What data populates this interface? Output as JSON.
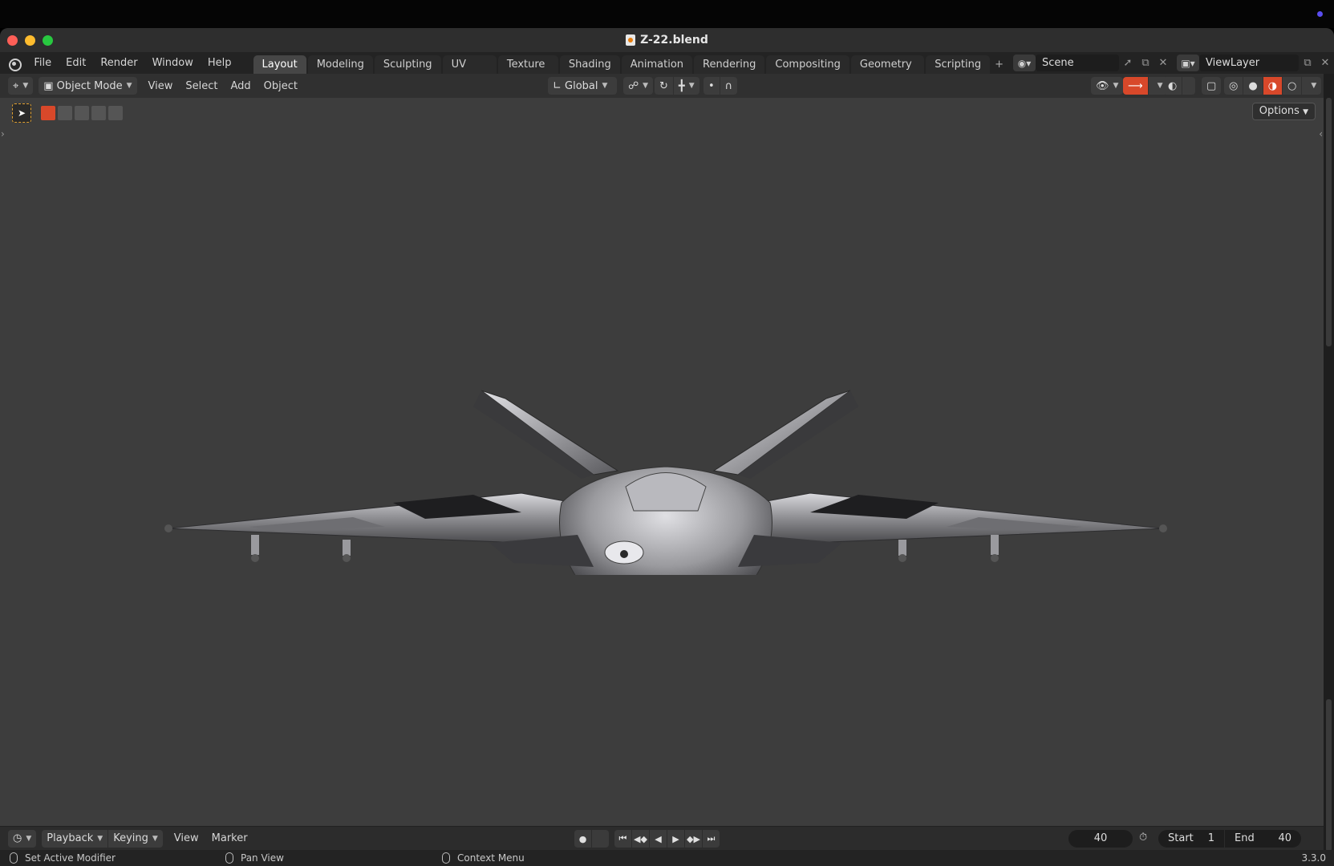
{
  "window": {
    "title": "Z-22.blend"
  },
  "menubar": {
    "items": [
      "File",
      "Edit",
      "Render",
      "Window",
      "Help"
    ],
    "workspace_tabs": [
      {
        "label": "Layout",
        "active": true
      },
      {
        "label": "Modeling",
        "active": false
      },
      {
        "label": "Sculpting",
        "active": false
      },
      {
        "label": "UV Editing",
        "active": false
      },
      {
        "label": "Texture Paint",
        "active": false
      },
      {
        "label": "Shading",
        "active": false
      },
      {
        "label": "Animation",
        "active": false
      },
      {
        "label": "Rendering",
        "active": false
      },
      {
        "label": "Compositing",
        "active": false
      },
      {
        "label": "Geometry Nodes",
        "active": false
      },
      {
        "label": "Scripting",
        "active": false
      }
    ],
    "add_tab": "+",
    "scene": "Scene",
    "view_layer": "ViewLayer"
  },
  "viewport_header": {
    "mode": "Object Mode",
    "menus": [
      "View",
      "Select",
      "Add",
      "Object"
    ],
    "transform_orientation": "Global"
  },
  "viewport": {
    "options_label": "Options",
    "object": "aircraft"
  },
  "timeline": {
    "menus": {
      "playback": "Playback",
      "keying": "Keying",
      "view": "View",
      "marker": "Marker"
    },
    "current_frame": "40",
    "start_label": "Start",
    "start_value": "1",
    "end_label": "End",
    "end_value": "40"
  },
  "statusbar": {
    "left": "Set Active Modifier",
    "middle": "Pan View",
    "right": "Context Menu",
    "version": "3.3.0"
  },
  "colors": {
    "accent_active": "#d8482a",
    "tab_active": "#464646",
    "viewport_bg": "#3d3d3d"
  }
}
